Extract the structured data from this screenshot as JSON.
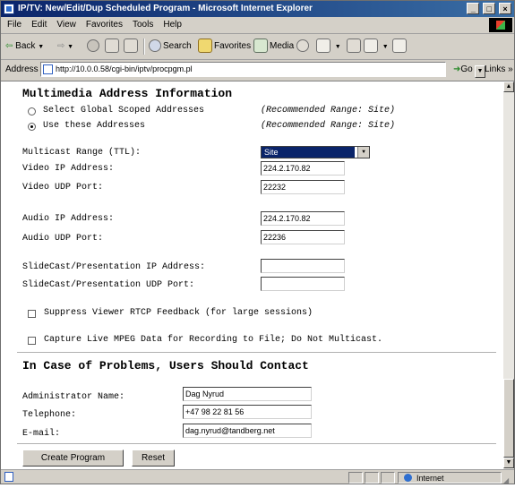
{
  "window": {
    "title": "IP/TV: New/Edit/Dup Scheduled Program - Microsoft Internet Explorer",
    "buttons": {
      "minimize": "_",
      "maximize": "□",
      "close": "×"
    }
  },
  "menu": [
    "File",
    "Edit",
    "View",
    "Favorites",
    "Tools",
    "Help"
  ],
  "toolbar": {
    "back": "Back",
    "search": "Search",
    "favorites": "Favorites",
    "media": "Media"
  },
  "address": {
    "label": "Address",
    "url": "http://10.0.0.58/cgi-bin/iptv/procpgm.pl",
    "go": "Go",
    "links": "Links »"
  },
  "form": {
    "multimedia_heading": "Multimedia Address Information",
    "radio_global": "Select Global Scoped Addresses",
    "radio_global_hint": "(Recommended Range: Site)",
    "radio_use": "Use these Addresses",
    "radio_use_hint": "(Recommended Range: Site)",
    "multicast_label": "Multicast Range (TTL):",
    "multicast_value": "Site",
    "video_ip_label": "Video IP Address:",
    "video_ip_value": "224.2.170.82",
    "video_udp_label": "Video UDP Port:",
    "video_udp_value": "22232",
    "audio_ip_label": "Audio IP Address:",
    "audio_ip_value": "224.2.170.82",
    "audio_udp_label": "Audio UDP Port:",
    "audio_udp_value": "22236",
    "slide_ip_label": "SlideCast/Presentation IP Address:",
    "slide_ip_value": "",
    "slide_udp_label": "SlideCast/Presentation UDP Port:",
    "slide_udp_value": "",
    "suppress_label": "Suppress Viewer RTCP Feedback (for large sessions)",
    "capture_label": "Capture Live MPEG Data for Recording to File; Do Not Multicast.",
    "problems_heading": "In Case of Problems, Users Should Contact",
    "admin_label": "Administrator Name:",
    "admin_value": "Dag Nyrud",
    "phone_label": "Telephone:",
    "phone_value": "+47 98 22 81 56",
    "email_label": "E-mail:",
    "email_value": "dag.nyrud@tandberg.net",
    "create_button": "Create Program",
    "reset_button": "Reset"
  },
  "status": {
    "zone": "Internet"
  }
}
